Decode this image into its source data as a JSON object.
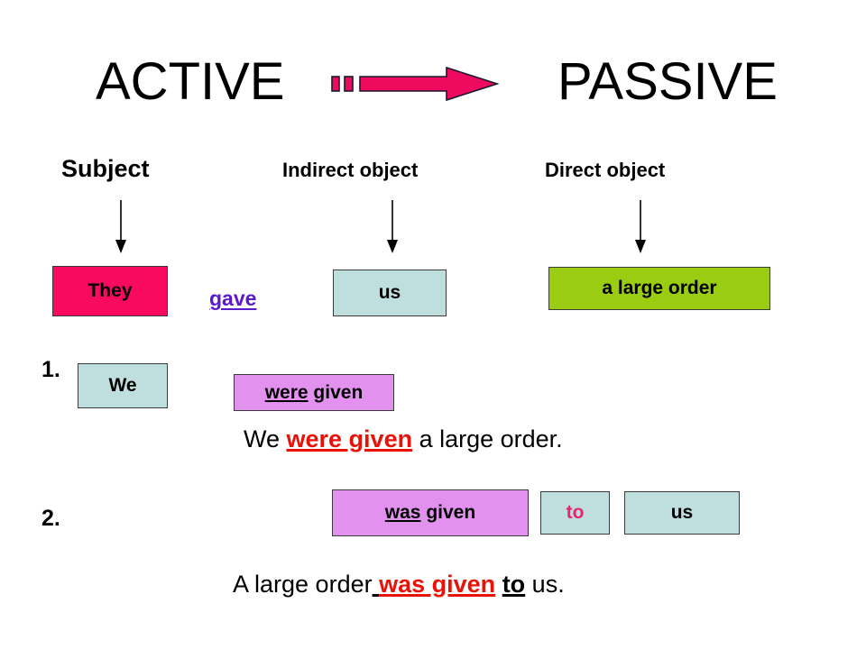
{
  "title": {
    "left_label": "ACTIVE",
    "right_label": "PASSIVE",
    "arrow_icon": "right-arrow-icon",
    "arrow_color": "#ee0a5e"
  },
  "column_headers": [
    {
      "label": "Subject"
    },
    {
      "label": "Indirect object"
    },
    {
      "label": "Direct object"
    }
  ],
  "active_sentence": {
    "subject": "They",
    "verb": "gave",
    "indirect_object": "us",
    "direct_object": "a large order",
    "subject_color": "#f80a5e",
    "verb_color": "#5a1acc",
    "object_color": "#bfdede",
    "direct_object_color": "#9acd11"
  },
  "transformations": [
    {
      "number": "1.",
      "subject": "We",
      "verb_aux": "were",
      "verb_participle": "given",
      "sentence": {
        "before": "We ",
        "highlight": "were given",
        "after": " a large order."
      }
    },
    {
      "number": "2.",
      "verb_aux": "was",
      "verb_participle": "given",
      "preposition": "to",
      "object": "us",
      "preposition_color": "#e8246c",
      "sentence": {
        "before": "A large order",
        "highlight": "was given",
        "middle": "to",
        "after": " us."
      }
    }
  ],
  "colors": {
    "pink": "#f80a5e",
    "green": "#9acd11",
    "light_blue": "#bfdede",
    "violet": "#e291ef",
    "red": "#e81208",
    "purple": "#5a1acc",
    "deep_pink": "#e8246c"
  }
}
